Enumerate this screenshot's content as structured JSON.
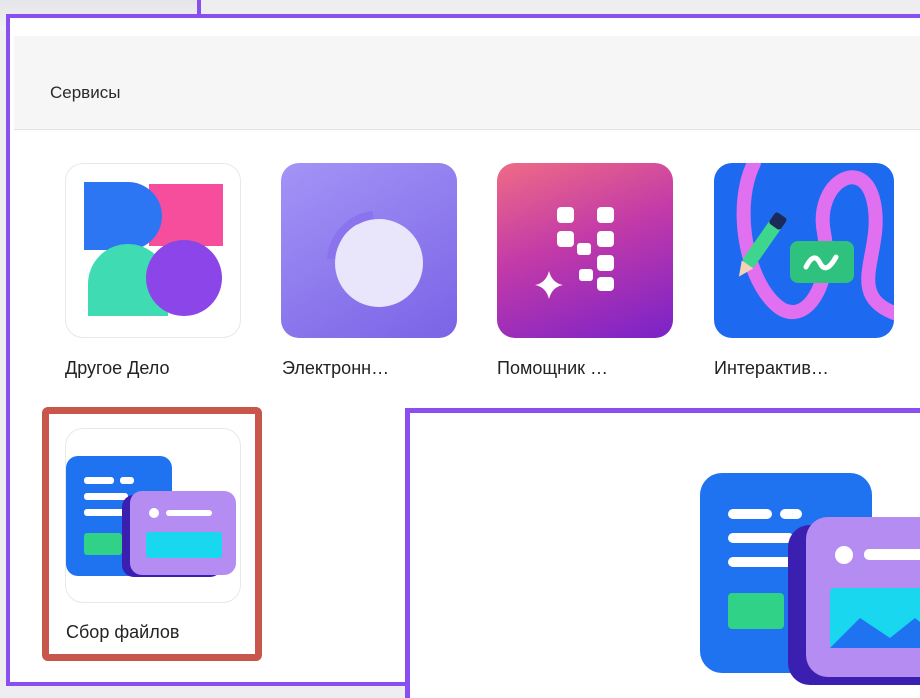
{
  "header": {
    "title": "Сервисы"
  },
  "services": [
    {
      "id": "drugoe-delo",
      "label": "Другое Дело",
      "icon": "drugoe-delo-icon"
    },
    {
      "id": "electronic",
      "label": "Электронн…",
      "icon": "electronic-journal-icon"
    },
    {
      "id": "assistant",
      "label": "Помощник …",
      "icon": "assistant-icon"
    },
    {
      "id": "interactive",
      "label": "Интерактив…",
      "icon": "interactive-board-icon"
    },
    {
      "id": "file-collection",
      "label": "Сбор файлов",
      "icon": "file-collection-icon"
    }
  ],
  "colors": {
    "frame": "#8a4ff0",
    "highlight": "#c8564a"
  }
}
